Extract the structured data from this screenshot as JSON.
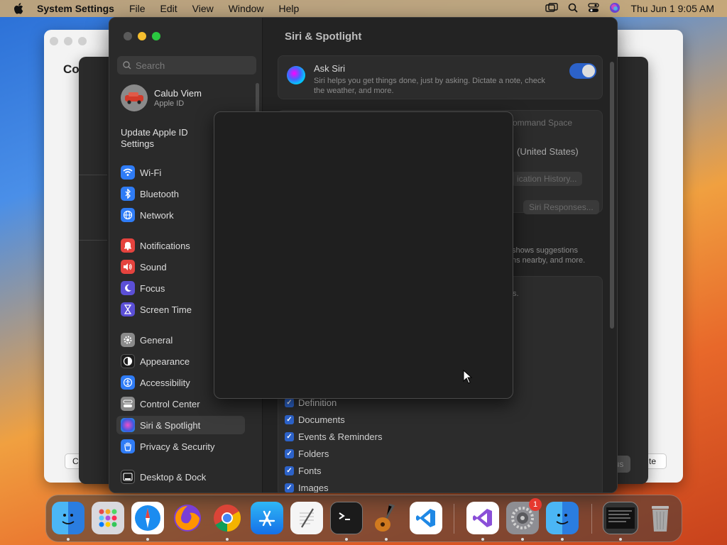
{
  "menubar": {
    "app_name": "System Settings",
    "items": [
      "File",
      "Edit",
      "View",
      "Window",
      "Help"
    ],
    "clock": "Thu Jun 1  9:05 AM"
  },
  "background_windows": {
    "light_title_fragment": "Co",
    "light_left_button": "C",
    "light_right_button": "te",
    "dark_button": "us"
  },
  "sidebar": {
    "search_placeholder": "Search",
    "account_name": "Calub Viem",
    "account_sub": "Apple ID",
    "update_notice": "Update Apple ID Settings",
    "items": [
      {
        "label": "Wi-Fi",
        "icon": "wifi-icon",
        "color": "#2f7cf6"
      },
      {
        "label": "Bluetooth",
        "icon": "bluetooth-icon",
        "color": "#2f7cf6"
      },
      {
        "label": "Network",
        "icon": "globe-icon",
        "color": "#2f7cf6"
      },
      {
        "label": "Notifications",
        "icon": "bell-icon",
        "color": "#e5433e"
      },
      {
        "label": "Sound",
        "icon": "speaker-icon",
        "color": "#e5433e"
      },
      {
        "label": "Focus",
        "icon": "moon-icon",
        "color": "#5b4fd6"
      },
      {
        "label": "Screen Time",
        "icon": "hourglass-icon",
        "color": "#5b4fd6"
      },
      {
        "label": "General",
        "icon": "gear-icon",
        "color": "#8a8a8a"
      },
      {
        "label": "Appearance",
        "icon": "appearance-icon",
        "color": "#1c1c1c"
      },
      {
        "label": "Accessibility",
        "icon": "accessibility-icon",
        "color": "#2f7cf6"
      },
      {
        "label": "Control Center",
        "icon": "control-center-icon",
        "color": "#8a8a8a"
      },
      {
        "label": "Siri & Spotlight",
        "icon": "siri-icon",
        "color": "#6a3fd6"
      },
      {
        "label": "Privacy & Security",
        "icon": "hand-icon",
        "color": "#2f7cf6"
      },
      {
        "label": "Desktop & Dock",
        "icon": "dock-icon",
        "color": "#1c1c1c"
      }
    ]
  },
  "content": {
    "title": "Siri & Spotlight",
    "ask_siri_title": "Ask Siri",
    "ask_siri_desc": "Siri helps you get things done, just by asking. Dictate a note, check the weather, and more.",
    "ask_siri_enabled": true,
    "shortcut_fragment": "ommand Space",
    "language_fragment": "(United States)",
    "history_button_fragment": "ication History...",
    "responses_button": "Siri Responses...",
    "suggestions_fragment_1": "shows suggestions",
    "suggestions_fragment_2": "ns nearby, and more.",
    "dot_fragment": "s.",
    "categories": [
      {
        "label": "Definition",
        "checked": true
      },
      {
        "label": "Documents",
        "checked": true
      },
      {
        "label": "Events & Reminders",
        "checked": true
      },
      {
        "label": "Folders",
        "checked": true
      },
      {
        "label": "Fonts",
        "checked": true
      },
      {
        "label": "Images",
        "checked": true
      }
    ]
  },
  "dock": {
    "apps": [
      "finder-icon",
      "launchpad-icon",
      "safari-icon",
      "firefox-icon",
      "chrome-icon",
      "app-store-icon",
      "textedit-icon",
      "terminal-icon",
      "garageband-icon",
      "vscode-icon",
      "visual-studio-icon",
      "system-settings-icon",
      "finder-alt-icon",
      "screen-capture-icon",
      "trash-icon"
    ],
    "settings_badge": "1"
  }
}
